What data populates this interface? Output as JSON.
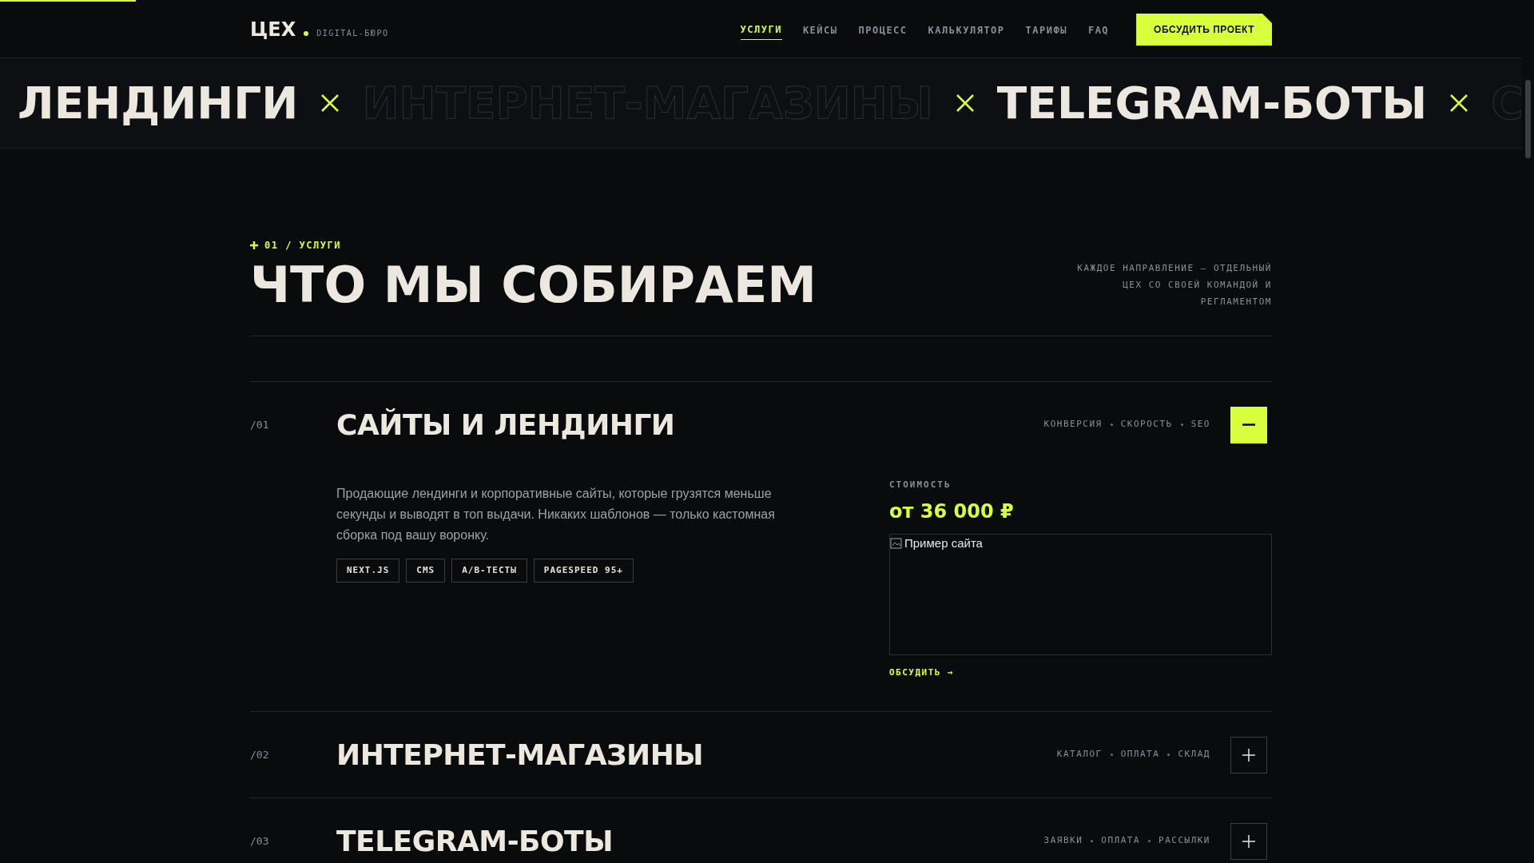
{
  "progress": {
    "level": 0.089
  },
  "header": {
    "logo": "ЦЕХ",
    "tagline": "DIGITAL-БЮРО",
    "nav": [
      {
        "label": "УСЛУГИ",
        "selected": true
      },
      {
        "label": "КЕЙСЫ",
        "selected": false
      },
      {
        "label": "ПРОЦЕСС",
        "selected": false
      },
      {
        "label": "КАЛЬКУЛЯТОР",
        "selected": false
      },
      {
        "label": "ТАРИФЫ",
        "selected": false
      },
      {
        "label": "FAQ",
        "selected": false
      }
    ],
    "cta": "ОБСУДИТЬ ПРОЕКТ"
  },
  "marquee": [
    {
      "text": "ЛЕНДИНГИ",
      "kind": "filled"
    },
    {
      "text": "ИНТЕРНЕТ-МАГАЗИНЫ",
      "kind": "outline"
    },
    {
      "text": "TELEGRAM-БОТЫ",
      "kind": "filled"
    },
    {
      "text": "С",
      "kind": "outline"
    }
  ],
  "section": {
    "eyebrow": "01 / УСЛУГИ",
    "title": "ЧТО МЫ СОБИРАЕМ",
    "note": "КАЖДОЕ НАПРАВЛЕНИЕ — ОТДЕЛЬНЫЙ ЦЕХ СО СВОЕЙ КОМАНДОЙ И РЕГЛАМЕНТОМ"
  },
  "services": [
    {
      "number": "/01",
      "title": "САЙТЫ И ЛЕНДИНГИ",
      "features": [
        "КОНВЕРСИЯ",
        "СКОРОСТЬ",
        "SEO"
      ],
      "expanded": true,
      "description": "Продающие лендинги и корпоративные сайты, которые грузятся меньше секунды и выводят в топ выдачи. Никаких шаблонов — только кастомная сборка под вашу воронку.",
      "tags": [
        "NEXT.JS",
        "CMS",
        "A/B-ТЕСТЫ",
        "PAGESPEED 95+"
      ],
      "price_label": "СТОИМОСТЬ",
      "price": "от 36 000 ₽",
      "image_alt": "Пример сайта",
      "link": "ОБСУДИТЬ →"
    },
    {
      "number": "/02",
      "title": "ИНТЕРНЕТ-МАГАЗИНЫ",
      "features": [
        "КАТАЛОГ",
        "ОПЛАТА",
        "СКЛАД"
      ],
      "expanded": false
    },
    {
      "number": "/03",
      "title": "TELEGRAM-БОТЫ",
      "features": [
        "ЗАЯВКИ",
        "ОПЛАТА",
        "РАССЫЛКИ"
      ],
      "expanded": false
    }
  ]
}
